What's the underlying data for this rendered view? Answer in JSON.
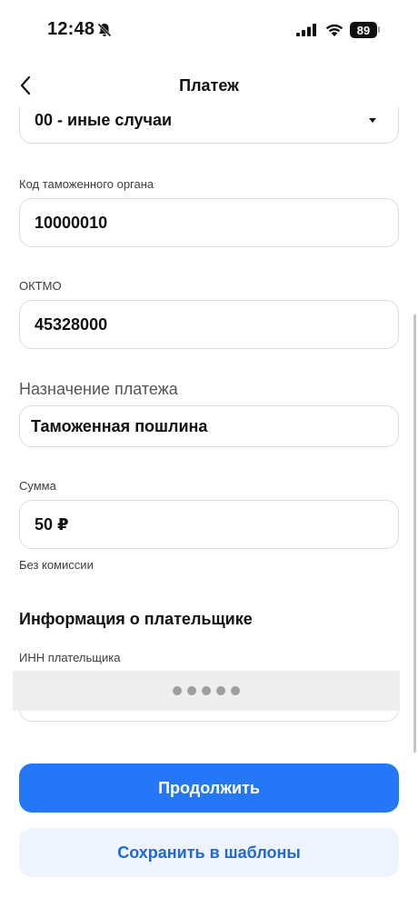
{
  "status_bar": {
    "time": "12:48",
    "battery": "89",
    "icons": [
      "bell-slash-icon",
      "signal-icon",
      "wifi-icon",
      "battery-icon"
    ]
  },
  "nav": {
    "title": "Платеж",
    "back_icon": "chevron-left-icon"
  },
  "form": {
    "basis_select": {
      "value": "00 - иные случаи"
    },
    "customs_code": {
      "label": "Код таможенного органа",
      "value": "10000010"
    },
    "oktmo": {
      "label": "ОКТМО",
      "value": "45328000"
    },
    "purpose": {
      "label": "Назначение платежа",
      "value": "Таможенная пошлина"
    },
    "amount": {
      "label": "Сумма",
      "value": "50 ₽",
      "hint": "Без комиссии"
    }
  },
  "payer": {
    "section_title": "Информация о плательщике",
    "inn_label": "ИНН плательщика"
  },
  "actions": {
    "continue_label": "Продолжить",
    "save_template_label": "Сохранить в шаблоны"
  },
  "colors": {
    "primary": "#2478f7",
    "secondary_bg": "#eef4fe",
    "secondary_text": "#2167d6"
  }
}
